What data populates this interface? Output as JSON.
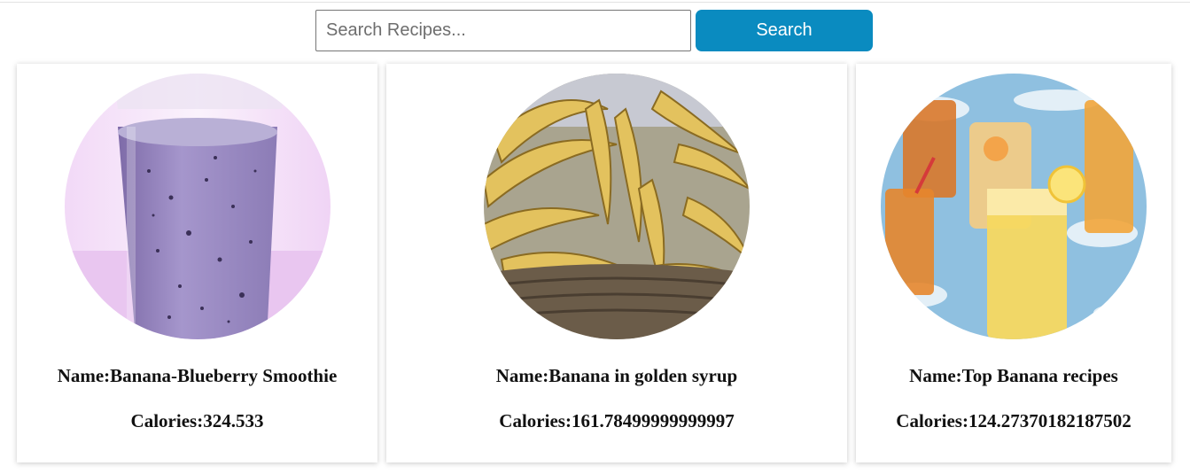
{
  "search": {
    "placeholder": "Search Recipes...",
    "value": "",
    "button_label": "Search"
  },
  "recipes": [
    {
      "name": "Name:Banana-Blueberry Smoothie",
      "calories": "Calories:324.533",
      "image": "blueberry-smoothie-glass"
    },
    {
      "name": "Name:Banana in golden syrup",
      "calories": "Calories:161.78499999999997",
      "image": "banana-basket"
    },
    {
      "name": "Name:Top Banana recipes",
      "calories": "Calories:124.27370182187502",
      "image": "iced-drinks"
    }
  ],
  "colors": {
    "accent": "#0a8bc0",
    "card_shadow": "#cccccc",
    "text": "#111111"
  }
}
